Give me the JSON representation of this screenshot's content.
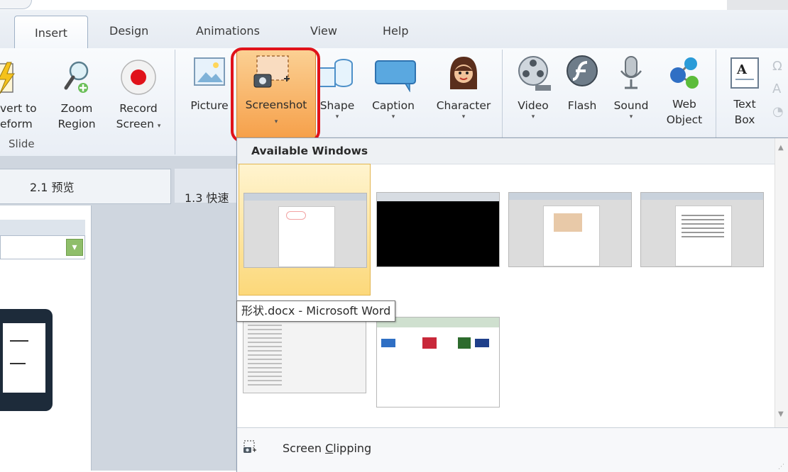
{
  "ribbon_tabs": [
    {
      "label": "Insert",
      "active": true
    },
    {
      "label": "Design"
    },
    {
      "label": "Animations"
    },
    {
      "label": "View"
    },
    {
      "label": "Help"
    }
  ],
  "slide_group": {
    "label": "Slide",
    "buttons": [
      {
        "line1": "vert to",
        "line2": "eform",
        "icon": "lightning-icon"
      },
      {
        "line1": "Zoom",
        "line2": "Region",
        "icon": "zoom-magnifier-icon"
      },
      {
        "line1": "Record",
        "line2": "Screen",
        "icon": "record-icon",
        "has_dropdown": true
      }
    ]
  },
  "media_group": {
    "buttons": [
      {
        "label": "Picture",
        "icon": "picture-icon"
      },
      {
        "label": "Screenshot",
        "icon": "camera-screenshot-icon",
        "has_dropdown": true,
        "state": "open"
      },
      {
        "label": "Shape",
        "icon": "shape-icon",
        "has_dropdown": true
      },
      {
        "label": "Caption",
        "icon": "caption-icon",
        "has_dropdown": true
      },
      {
        "label": "Character",
        "icon": "character-avatar-icon",
        "has_dropdown": true
      }
    ]
  },
  "av_group": {
    "buttons": [
      {
        "label": "Video",
        "icon": "film-reel-icon",
        "has_dropdown": true
      },
      {
        "label": "Flash",
        "icon": "flash-icon"
      },
      {
        "label": "Sound",
        "icon": "microphone-icon",
        "has_dropdown": true
      },
      {
        "line1": "Web",
        "line2": "Object",
        "icon": "web-object-icon"
      }
    ]
  },
  "text_group": {
    "buttons": [
      {
        "line1": "Text",
        "line2": "Box",
        "icon": "text-box-icon"
      }
    ]
  },
  "outline_tabs": {
    "tab1": "2.1 预览",
    "tab2": "1.3 快速"
  },
  "screenshot_dropdown": {
    "header": "Available Windows",
    "tooltip": "形状.docx - Microsoft Word",
    "footer_label_prefix": "Screen ",
    "footer_label_accel": "C",
    "footer_label_rest": "lipping",
    "thumbnails": [
      {
        "kind": "word-document",
        "selected": true
      },
      {
        "kind": "black-window"
      },
      {
        "kind": "word-document-with-image"
      },
      {
        "kind": "word-document-text"
      },
      {
        "kind": "file-list-window"
      },
      {
        "kind": "image-gallery-window"
      }
    ]
  },
  "colors": {
    "active_button_orange": "#f6a04a",
    "highlight_red": "#e0121a",
    "selected_thumb_yellow": "#fcd87a"
  }
}
